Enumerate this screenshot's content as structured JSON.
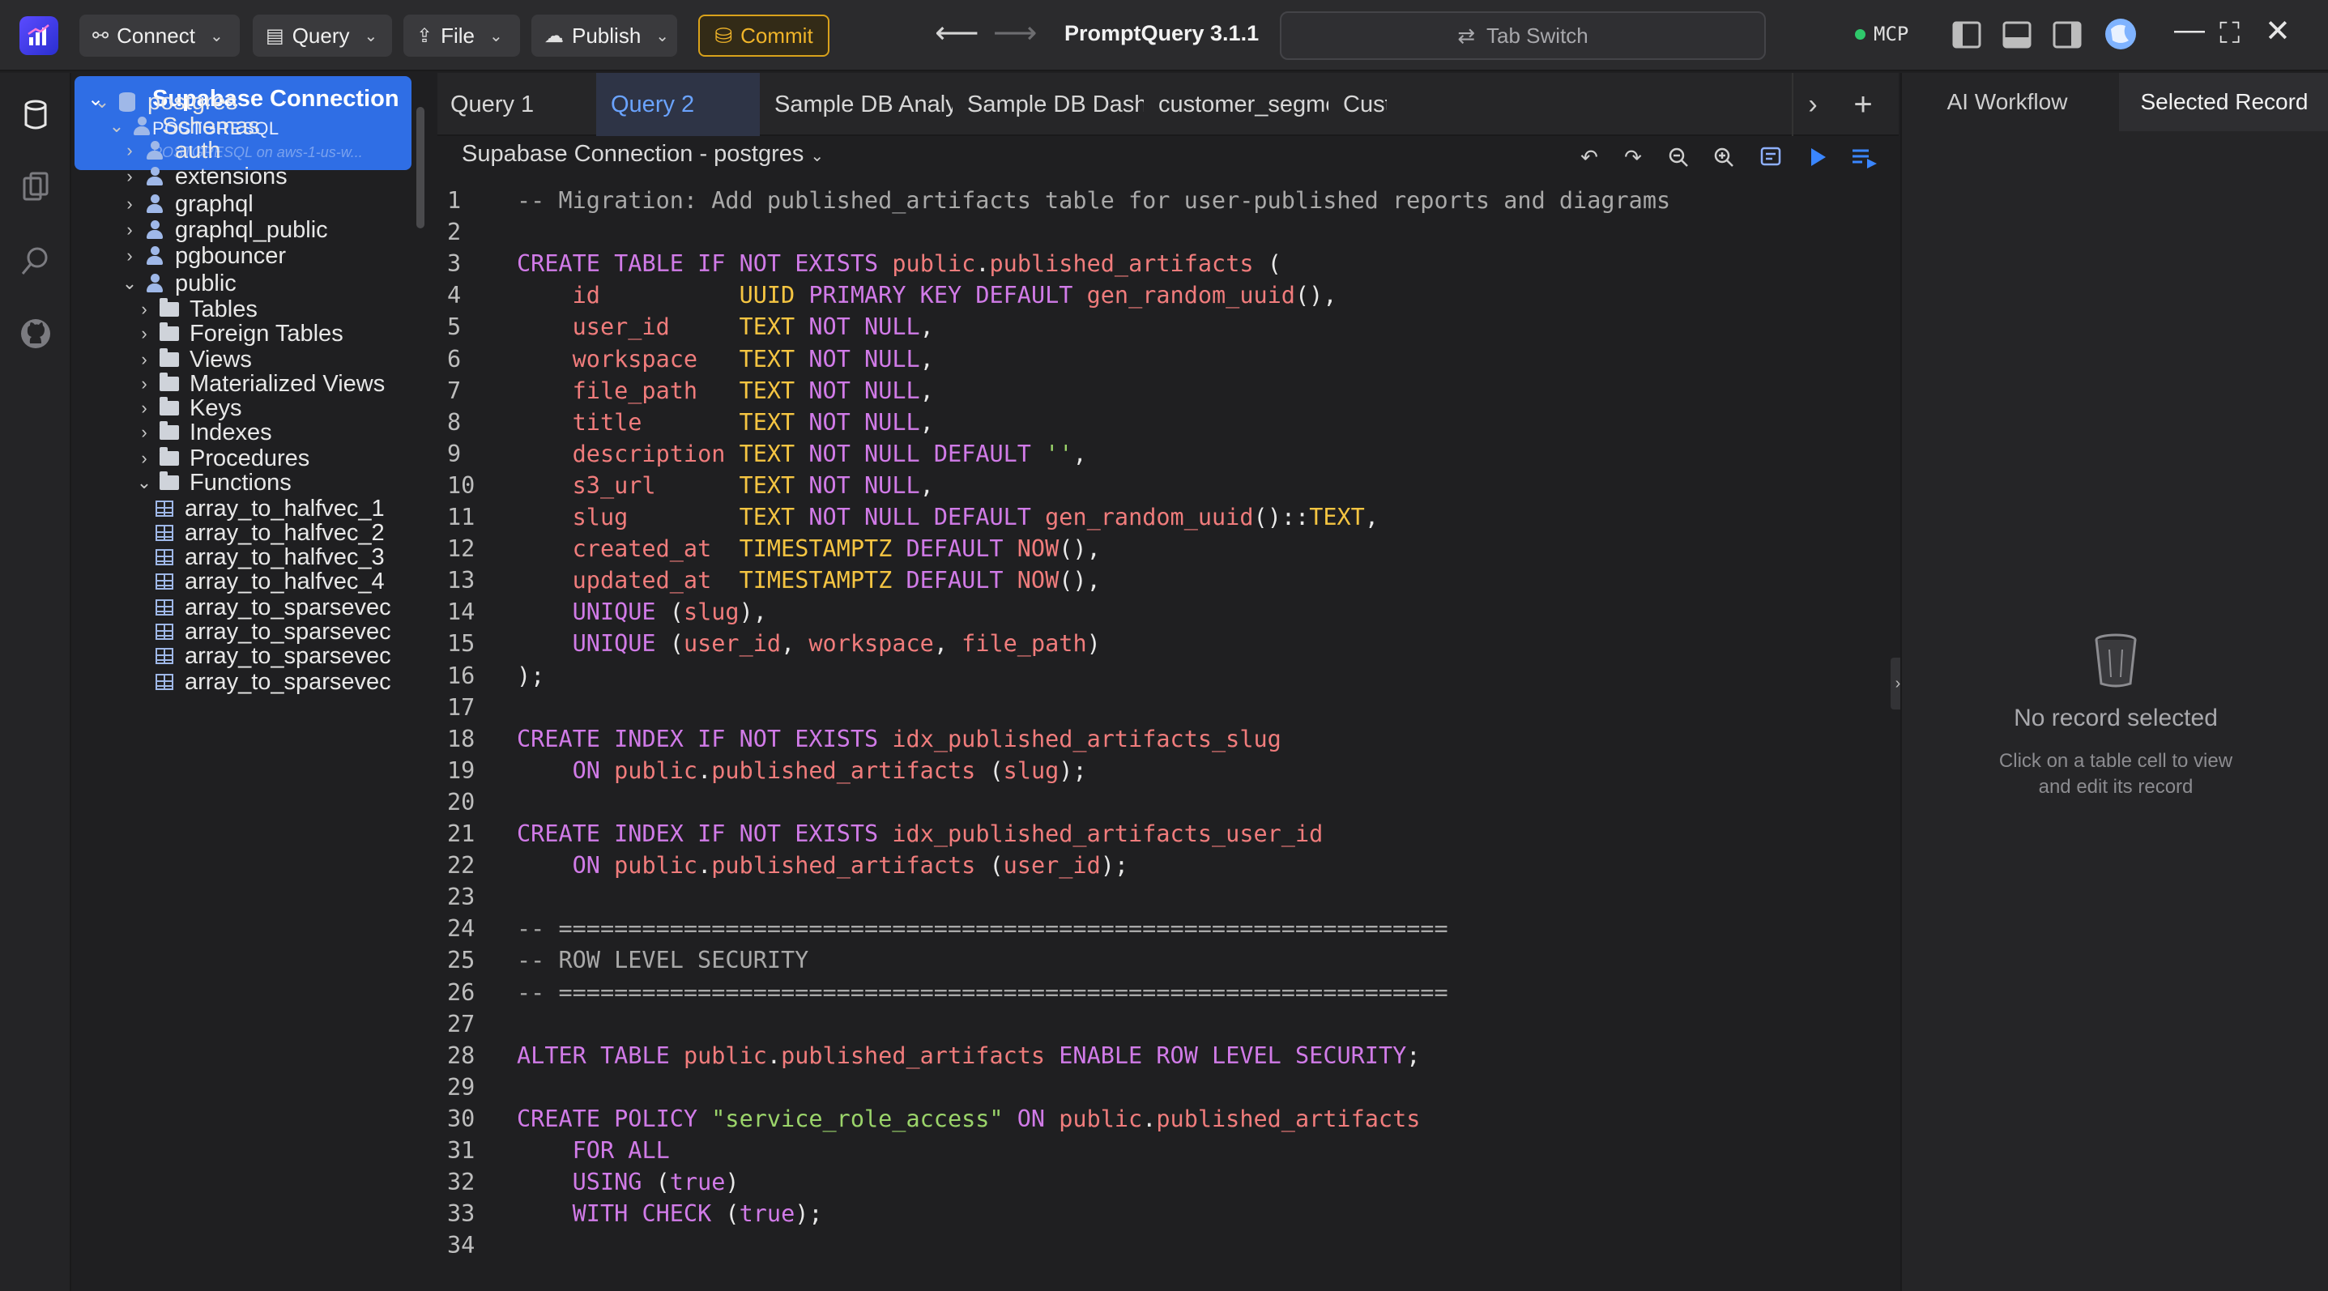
{
  "titlebar": {
    "menus": [
      {
        "label": "Connect",
        "icon": "plug-icon"
      },
      {
        "label": "Query",
        "icon": "query-icon"
      },
      {
        "label": "File",
        "icon": "upload-icon"
      },
      {
        "label": "Publish",
        "icon": "cloud-icon"
      }
    ],
    "commit_label": "Commit",
    "app_title": "PromptQuery 3.1.1",
    "tab_switch_label": "Tab Switch",
    "mcp_label": "MCP",
    "mcp_status_color": "#2fc96b"
  },
  "explorer": {
    "connection": {
      "name": "Supabase Connection",
      "type": "POSTGRESQL",
      "host": "POSTGRESQL on aws-1-us-w..."
    },
    "tree": [
      {
        "label": "postgres",
        "icon": "database-icon",
        "expanded": true
      },
      {
        "label": "Schemas",
        "icon": "schemas-icon",
        "expanded": true
      },
      {
        "label": "auth",
        "icon": "schema-icon",
        "expanded": false
      },
      {
        "label": "extensions",
        "icon": "schema-icon",
        "expanded": false
      },
      {
        "label": "graphql",
        "icon": "schema-icon",
        "expanded": false
      },
      {
        "label": "graphql_public",
        "icon": "schema-icon",
        "expanded": false
      },
      {
        "label": "pgbouncer",
        "icon": "schema-icon",
        "expanded": false
      },
      {
        "label": "public",
        "icon": "schema-icon",
        "expanded": true
      },
      {
        "label": "Tables",
        "icon": "folder-icon",
        "expanded": false
      },
      {
        "label": "Foreign Tables",
        "icon": "folder-icon",
        "expanded": false
      },
      {
        "label": "Views",
        "icon": "folder-icon",
        "expanded": false
      },
      {
        "label": "Materialized Views",
        "icon": "folder-icon",
        "expanded": false
      },
      {
        "label": "Keys",
        "icon": "folder-icon",
        "expanded": false
      },
      {
        "label": "Indexes",
        "icon": "folder-icon",
        "expanded": false
      },
      {
        "label": "Procedures",
        "icon": "folder-icon",
        "expanded": false
      },
      {
        "label": "Functions",
        "icon": "folder-icon",
        "expanded": true
      },
      {
        "label": "array_to_halfvec_1",
        "icon": "function-icon"
      },
      {
        "label": "array_to_halfvec_2",
        "icon": "function-icon"
      },
      {
        "label": "array_to_halfvec_3",
        "icon": "function-icon"
      },
      {
        "label": "array_to_halfvec_4",
        "icon": "function-icon"
      },
      {
        "label": "array_to_sparsevec",
        "icon": "function-icon"
      },
      {
        "label": "array_to_sparsevec",
        "icon": "function-icon"
      },
      {
        "label": "array_to_sparsevec",
        "icon": "function-icon"
      },
      {
        "label": "array_to_sparsevec",
        "icon": "function-icon"
      }
    ]
  },
  "editor": {
    "tabs": [
      {
        "label": "Query 1",
        "active": false
      },
      {
        "label": "Query 2",
        "active": true
      },
      {
        "label": "Sample DB Analysis ...",
        "active": false
      },
      {
        "label": "Sample DB Dashboard",
        "active": false
      },
      {
        "label": "customer_segments....",
        "active": false
      },
      {
        "label": "Cust",
        "active": false
      }
    ],
    "connection_label": "Supabase Connection - postgres",
    "toolbar": [
      "undo-icon",
      "redo-icon",
      "zoom-out-icon",
      "zoom-in-icon",
      "format-icon",
      "run-icon",
      "run-list-icon"
    ],
    "accent_color": "#3a86ff",
    "lines": [
      "-- Migration: Add published_artifacts table for user-published reports and diagrams",
      "",
      "CREATE TABLE IF NOT EXISTS public.published_artifacts (",
      "    id          UUID PRIMARY KEY DEFAULT gen_random_uuid(),",
      "    user_id     TEXT NOT NULL,",
      "    workspace   TEXT NOT NULL,",
      "    file_path   TEXT NOT NULL,",
      "    title       TEXT NOT NULL,",
      "    description TEXT NOT NULL DEFAULT '',",
      "    s3_url      TEXT NOT NULL,",
      "    slug        TEXT NOT NULL DEFAULT gen_random_uuid()::TEXT,",
      "    created_at  TIMESTAMPTZ DEFAULT NOW(),",
      "    updated_at  TIMESTAMPTZ DEFAULT NOW(),",
      "    UNIQUE (slug),",
      "    UNIQUE (user_id, workspace, file_path)",
      ");",
      "",
      "CREATE INDEX IF NOT EXISTS idx_published_artifacts_slug",
      "    ON public.published_artifacts (slug);",
      "",
      "CREATE INDEX IF NOT EXISTS idx_published_artifacts_user_id",
      "    ON public.published_artifacts (user_id);",
      "",
      "-- ================================================================",
      "-- ROW LEVEL SECURITY",
      "-- ================================================================",
      "",
      "ALTER TABLE public.published_artifacts ENABLE ROW LEVEL SECURITY;",
      "",
      "CREATE POLICY \"service_role_access\" ON public.published_artifacts",
      "    FOR ALL",
      "    USING (true)",
      "    WITH CHECK (true);",
      ""
    ]
  },
  "right_panel": {
    "tabs": [
      {
        "label": "AI Workflow",
        "active": false
      },
      {
        "label": "Selected Record",
        "active": true
      }
    ],
    "empty_title": "No record selected",
    "empty_subtitle_line1": "Click on a table cell to view",
    "empty_subtitle_line2": "and edit its record"
  }
}
